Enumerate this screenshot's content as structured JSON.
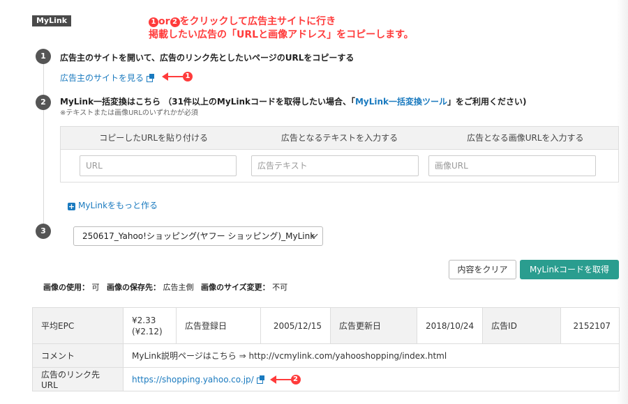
{
  "badge": "MyLink",
  "annotation": {
    "circle1": "1",
    "line1": "or",
    "circle2": "2",
    "line1_rest": "をクリックして広告主サイトに行き",
    "line2": "掲載したい広告の「URLと画像アドレス」をコピーします。"
  },
  "step1": {
    "num": "1",
    "title": "広告主のサイトを開いて、広告のリンク先としたいページのURLをコピーする",
    "link": "広告主のサイトを見る",
    "arrow_num": "1"
  },
  "step2": {
    "num": "2",
    "title_pre": "MyLink一括変換はこちら （31件以上のMyLinkコードを取得したい場合、「",
    "title_link": "MyLink一括変換ツール",
    "title_post": "」をご利用ください)",
    "note": "※テキストまたは画像URLのいずれかが必須",
    "columns": [
      "コピーしたURLを貼り付ける",
      "広告となるテキストを入力する",
      "広告となる画像URLを入力する"
    ],
    "placeholders": [
      "URL",
      "広告テキスト",
      "画像URL"
    ],
    "more": "MyLinkをもっと作る"
  },
  "step3": {
    "num": "3",
    "select_value": "250617_Yahoo!ショッピング(ヤフー ショッピング)_MyLink"
  },
  "buttons": {
    "clear": "内容をクリア",
    "get": "MyLinkコードを取得"
  },
  "usage": {
    "use_label": "画像の使用：",
    "use_value": "可",
    "save_label": "画像の保存先：",
    "save_value": "広告主側",
    "resize_label": "画像のサイズ変更：",
    "resize_value": "不可"
  },
  "info": {
    "epc_label": "平均EPC",
    "epc_value": "¥2.33",
    "epc_sub": "(¥2.12)",
    "reg_label": "広告登録日",
    "reg_value": "2005/12/15",
    "upd_label": "広告更新日",
    "upd_value": "2018/10/24",
    "id_label": "広告ID",
    "id_value": "2152107",
    "comment_label": "コメント",
    "comment_value": "MyLink説明ページはこちら ⇒ http://vcmylink.com/yahooshopping/index.html",
    "url_label": "広告のリンク先URL",
    "url_value": "https://shopping.yahoo.co.jp/",
    "arrow_num": "2"
  },
  "colors": {
    "accent": "#2a9d8f",
    "link": "#1a7abf",
    "annotation": "#ff3b3b"
  }
}
